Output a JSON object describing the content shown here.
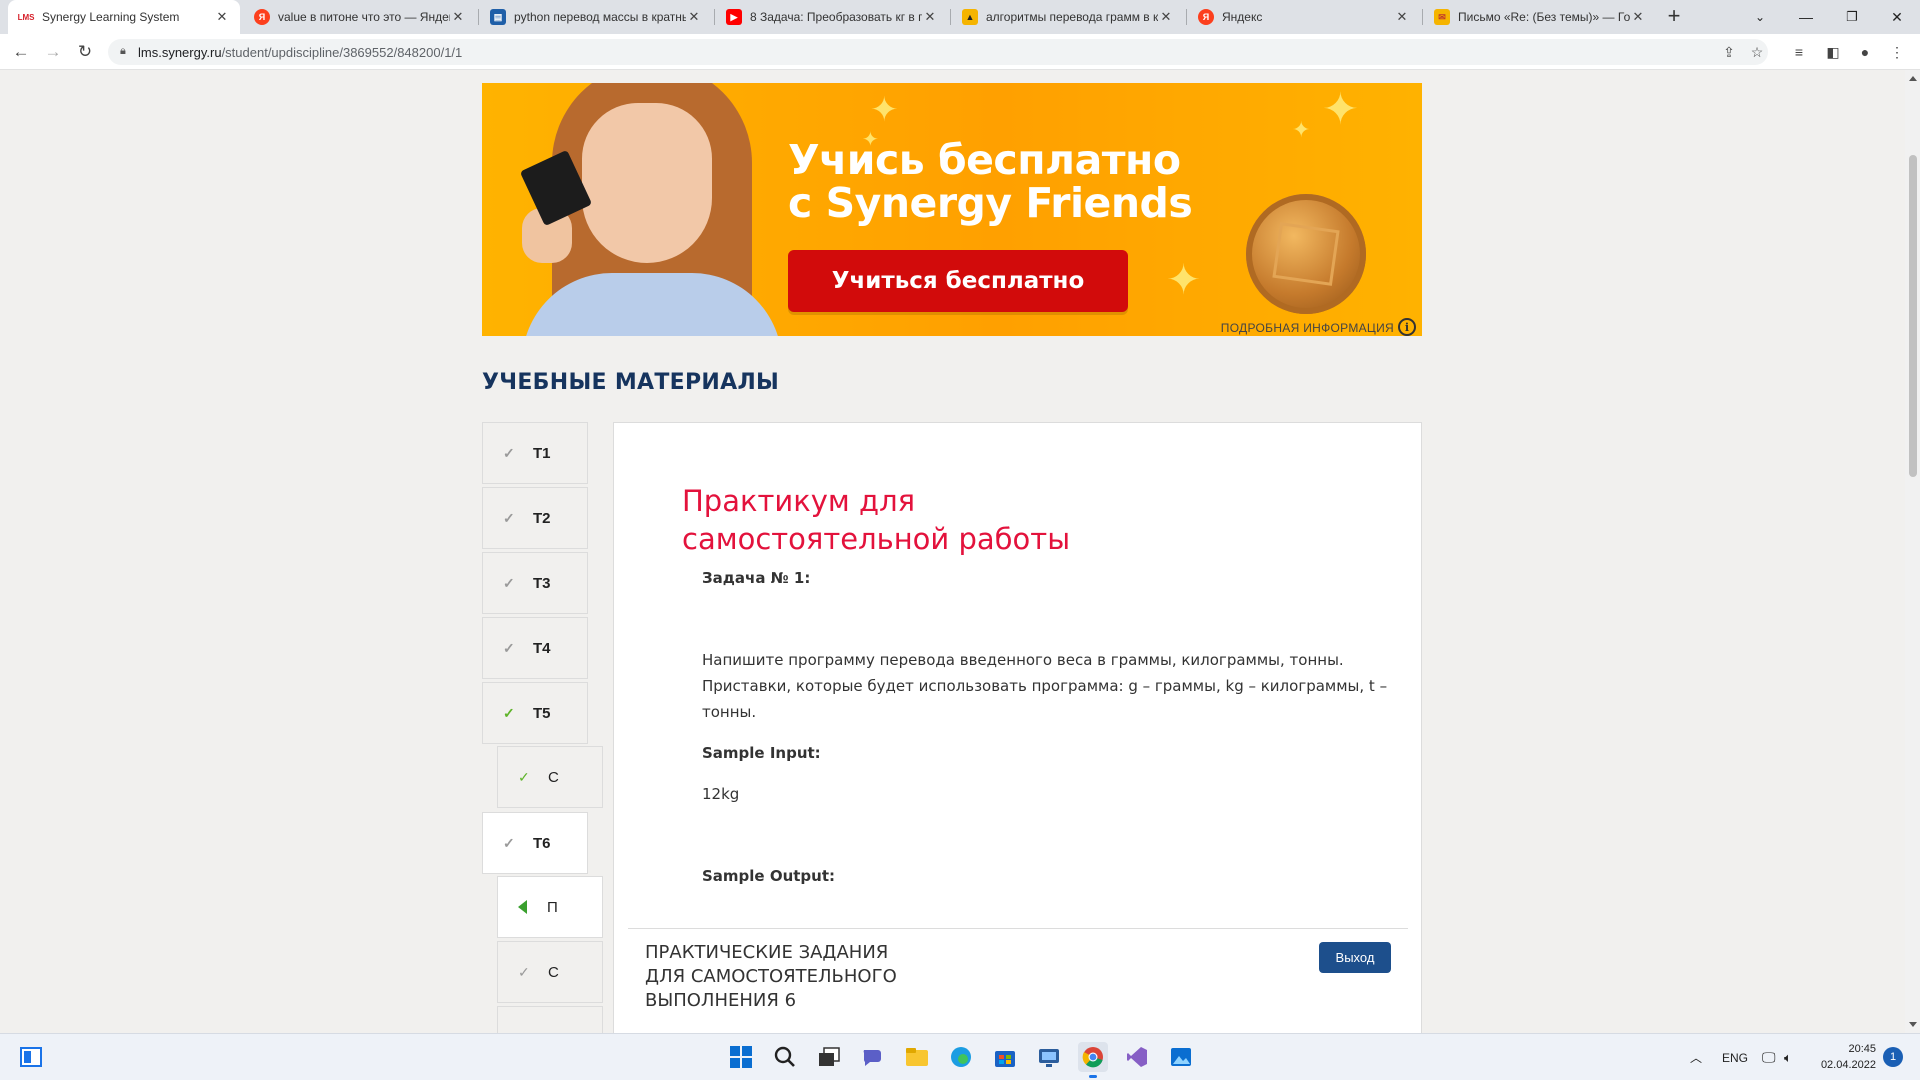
{
  "browser": {
    "tabs": [
      {
        "title": "Synergy Learning System",
        "favicon": "lms-logo-icon",
        "fav_color": "#ffffff",
        "fav_text": "LMS",
        "active": true
      },
      {
        "title": "value в питоне что это — Яндекс",
        "favicon": "yandex-icon",
        "fav_color": "#fc3f1d",
        "fav_text": "Я"
      },
      {
        "title": "python перевод массы в кратные",
        "favicon": "doc-icon",
        "fav_color": "#1f5fa8",
        "fav_text": "▤"
      },
      {
        "title": "8 Задача: Преобразовать кг в г",
        "favicon": "youtube-icon",
        "fav_color": "#ff0000",
        "fav_text": "▶"
      },
      {
        "title": "алгоритмы перевода грамм в кг",
        "favicon": "image-icon",
        "fav_color": "#f5b400",
        "fav_text": "▲"
      },
      {
        "title": "Яндекс",
        "favicon": "yandex-icon",
        "fav_color": "#fc3f1d",
        "fav_text": "Я"
      },
      {
        "title": "Письмо «Re: (Без темы)» — Голо",
        "favicon": "mail-icon",
        "fav_color": "#f5b400",
        "fav_text": "✉"
      }
    ],
    "url_host": "lms.synergy.ru",
    "url_path": "/student/updiscipline/3869552/848200/1/1"
  },
  "banner": {
    "headline_line1": "Учись бесплатно",
    "headline_line2": "с Synergy Friends",
    "cta_label": "Учиться бесплатно",
    "more_info": "ПОДРОБНАЯ ИНФОРМАЦИЯ"
  },
  "section_title": "УЧЕБНЫЕ МАТЕРИАЛЫ",
  "sidebar": {
    "items": [
      {
        "label": "T1",
        "check": "done"
      },
      {
        "label": "T2",
        "check": "done"
      },
      {
        "label": "T3",
        "check": "done"
      },
      {
        "label": "T4",
        "check": "done"
      },
      {
        "label": "T5",
        "check": "done-green"
      },
      {
        "label": "C",
        "check": "done-green",
        "sub": true
      },
      {
        "label": "T6",
        "check": "done",
        "selected": true
      },
      {
        "label": "П",
        "check": "current",
        "sub": true
      },
      {
        "label": "C",
        "check": "done",
        "sub": true
      }
    ]
  },
  "content": {
    "title_line1": "Практикум для",
    "title_line2": "самостоятельной работы",
    "task_label": "Задача № 1:",
    "task_text_line1": "Напишите программу перевода введенного веса в граммы, килограммы, тонны.",
    "task_text_line2": "Приставки, которые будет использовать программа: g – граммы, kg – килограммы, t –",
    "task_text_line3": "тонны.",
    "sample_input_label": "Sample Input:",
    "sample_input_value": "12kg",
    "sample_output_label": "Sample Output:",
    "footer_title": "ПРАКТИЧЕСКИЕ ЗАДАНИЯ ДЛЯ САМОСТОЯТЕЛЬНОГО ВЫПОЛНЕНИЯ 6",
    "exit_label": "Выход"
  },
  "taskbar": {
    "lang": "ENG",
    "time": "20:45",
    "date": "02.04.2022",
    "notifications": "1"
  },
  "colors": {
    "accent_red": "#e3123c",
    "title_blue": "#16345e",
    "exit_blue": "#1d4f8c",
    "banner_orange": "#ffa000",
    "cta_red": "#d20b0b"
  }
}
